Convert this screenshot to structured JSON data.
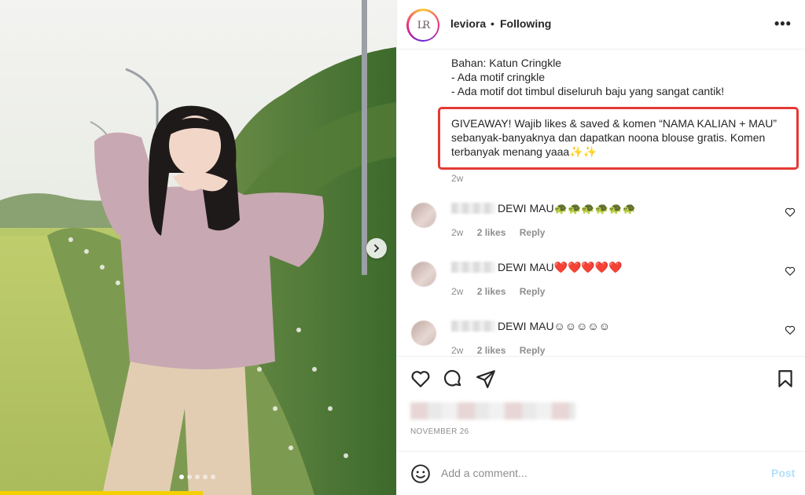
{
  "header": {
    "username": "leviora",
    "separator": "•",
    "follow_status": "Following",
    "more_label": "•••",
    "avatar_text": "LR"
  },
  "caption": {
    "lines": [
      "Bahan: Katun Cringkle",
      "- Ada motif cringkle",
      "- Ada motif dot timbul diseluruh baju yang sangat cantik!"
    ],
    "giveaway": "GIVEAWAY! Wajib likes & saved & komen “NAMA KALIAN + MAU” sebanyak-banyaknya dan dapatkan noona blouse gratis. Komen terbanyak menang yaaa✨✨",
    "time": "2w"
  },
  "comments": [
    {
      "text": "DEWI MAU🐢🐢🐢🐢🐢🐢",
      "time": "2w",
      "likes": "2 likes",
      "reply": "Reply"
    },
    {
      "text": "DEWI MAU❤️❤️❤️❤️❤️",
      "time": "2w",
      "likes": "2 likes",
      "reply": "Reply"
    },
    {
      "text": "DEWI MAU☺☺☺☺☺",
      "time": "2w",
      "likes": "2 likes",
      "reply": "Reply"
    }
  ],
  "post": {
    "date": "NOVEMBER 26"
  },
  "add_comment": {
    "placeholder": "Add a comment...",
    "post_label": "Post"
  },
  "colors": {
    "highlight_border": "#e53935",
    "post_button": "#b2dffc",
    "muted_text": "#8e8e8e"
  },
  "icons": {
    "like": "heart-icon",
    "comment": "comment-icon",
    "share": "paper-plane-icon",
    "save": "bookmark-icon",
    "emoji": "smiley-icon",
    "next": "chevron-right-icon"
  },
  "carousel": {
    "slides": 5,
    "active_slide": 1
  }
}
